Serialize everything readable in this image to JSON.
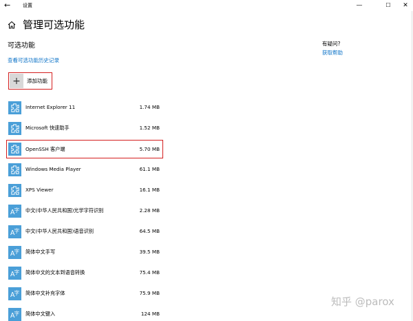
{
  "titlebar": {
    "back_glyph": "←",
    "title": "设置",
    "minimize_glyph": "—",
    "maximize_glyph": "☐",
    "close_glyph": "✕"
  },
  "header": {
    "home_icon": "home-icon",
    "title": "管理可选功能"
  },
  "main": {
    "section_heading": "可选功能",
    "history_link": "查看可选功能历史记录",
    "add_feature": {
      "icon_glyph": "+",
      "label": "添加功能"
    },
    "features": [
      {
        "name": "Internet Explorer 11",
        "size": "1.74 MB",
        "icon": "puzzle-icon"
      },
      {
        "name": "Microsoft 快速助手",
        "size": "1.52 MB",
        "icon": "puzzle-icon"
      },
      {
        "name": "OpenSSH 客户端",
        "size": "5.70 MB",
        "icon": "puzzle-icon"
      },
      {
        "name": "Windows Media Player",
        "size": "61.1 MB",
        "icon": "puzzle-icon"
      },
      {
        "name": "XPS Viewer",
        "size": "16.1 MB",
        "icon": "puzzle-icon"
      },
      {
        "name": "中文(中华人民共和国)光学字符识别",
        "size": "2.28 MB",
        "icon": "language-icon"
      },
      {
        "name": "中文(中华人民共和国)语音识别",
        "size": "64.5 MB",
        "icon": "language-icon"
      },
      {
        "name": "简体中文手写",
        "size": "39.5 MB",
        "icon": "language-icon"
      },
      {
        "name": "简体中文的文本到语音转换",
        "size": "75.4 MB",
        "icon": "language-icon"
      },
      {
        "name": "简体中文补充字体",
        "size": "75.9 MB",
        "icon": "language-icon"
      },
      {
        "name": "简体中文键入",
        "size": "124 MB",
        "icon": "language-icon"
      }
    ]
  },
  "help": {
    "title": "有疑问?",
    "link": "获取帮助"
  },
  "watermark": "知乎 @parox",
  "colors": {
    "accent": "#0b72c7",
    "icon_tile": "#4a9fd8",
    "highlight_border": "#d41d1d"
  }
}
